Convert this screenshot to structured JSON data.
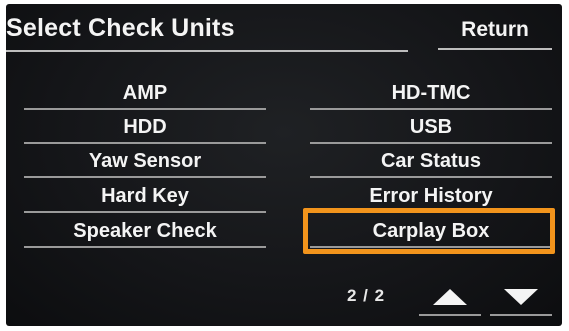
{
  "header": {
    "title": "Select Check Units",
    "return_label": "Return"
  },
  "units": {
    "left": [
      {
        "label": "AMP"
      },
      {
        "label": "HDD"
      },
      {
        "label": "Yaw Sensor"
      },
      {
        "label": "Hard Key"
      },
      {
        "label": "Speaker Check"
      }
    ],
    "right": [
      {
        "label": "HD-TMC"
      },
      {
        "label": "USB"
      },
      {
        "label": "Car Status"
      },
      {
        "label": "Error History"
      },
      {
        "label": "Carplay Box"
      }
    ]
  },
  "highlighted_item": "Carplay Box",
  "pagination": {
    "page_text": "2 / 2",
    "up_icon": "triangle-up-icon",
    "down_icon": "triangle-down-icon"
  },
  "colors": {
    "screen_background": "#151619",
    "text": "#f4f4f4",
    "highlight": "#f2941c",
    "divider": "#9a9a9a"
  }
}
